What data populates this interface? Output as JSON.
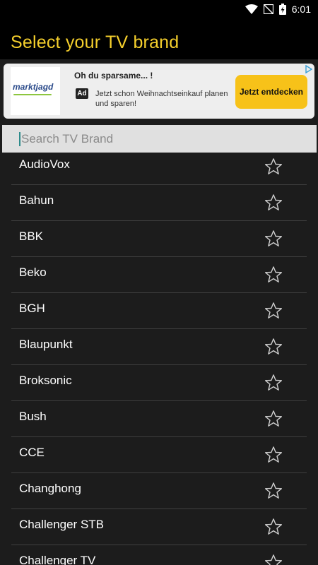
{
  "status_bar": {
    "time": "6:01",
    "icons": [
      "wifi-icon",
      "no-signal-icon",
      "battery-charging-icon"
    ]
  },
  "header": {
    "title": "Select your TV brand",
    "title_color": "#f5cf2c"
  },
  "ad": {
    "logo_text": "marktjagd",
    "title": "Oh du sparsame... !",
    "badge": "Ad",
    "description": "Jetzt schon Weihnachtseinkauf planen und sparen!",
    "cta": "Jetzt entdecken",
    "cta_color": "#f7c219"
  },
  "search": {
    "placeholder": "Search TV Brand",
    "value": ""
  },
  "brands": [
    {
      "name": "AudioVox",
      "favorite": false
    },
    {
      "name": "Bahun",
      "favorite": false
    },
    {
      "name": "BBK",
      "favorite": false
    },
    {
      "name": "Beko",
      "favorite": false
    },
    {
      "name": "BGH",
      "favorite": false
    },
    {
      "name": "Blaupunkt",
      "favorite": false
    },
    {
      "name": "Broksonic",
      "favorite": false
    },
    {
      "name": "Bush",
      "favorite": false
    },
    {
      "name": "CCE",
      "favorite": false
    },
    {
      "name": "Changhong",
      "favorite": false
    },
    {
      "name": "Challenger STB",
      "favorite": false
    },
    {
      "name": "Challenger TV",
      "favorite": false
    }
  ]
}
